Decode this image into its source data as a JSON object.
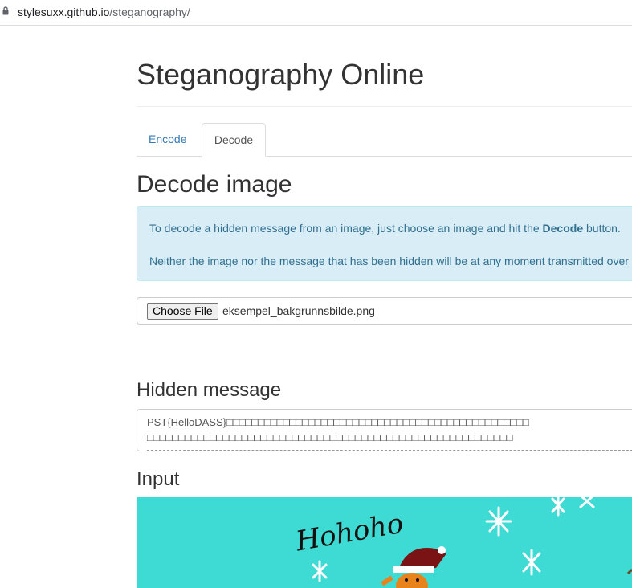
{
  "browser": {
    "url_host": "stylesuxx.github.io",
    "url_path": "/steganography/"
  },
  "page": {
    "title": "Steganography Online",
    "tabs": [
      {
        "label": "Encode",
        "active": false
      },
      {
        "label": "Decode",
        "active": true
      }
    ],
    "section_title": "Decode image",
    "info": {
      "line1_before": "To decode a hidden message from an image, just choose an image and hit the ",
      "line1_bold": "Decode",
      "line1_after": " button.",
      "line2": "Neither the image nor the message that has been hidden will be at any moment transmitted over t"
    },
    "file_input": {
      "button_label": "Choose File",
      "file_name": "eksempel_bakgrunnsbilde.png"
    },
    "hidden_message": {
      "heading": "Hidden message",
      "line1": "PST{HelloDASS}□□□□□□□□□□□□□□□□□□□□□□□□□□□□□□□□□□□□□□□□□□□□□□□□",
      "line2": "□□□□□□□□□□□□□□□□□□□□□□□□□□□□□□□□□□□□□□□□□□□□□□□□□□□□□□□□□□"
    },
    "input_section": {
      "heading": "Input",
      "image_text": "Hohoho",
      "image_bg": "#3ddbd4"
    }
  },
  "colors": {
    "link": "#337ab7",
    "alert_bg": "#d9edf7",
    "alert_text": "#31708f"
  }
}
